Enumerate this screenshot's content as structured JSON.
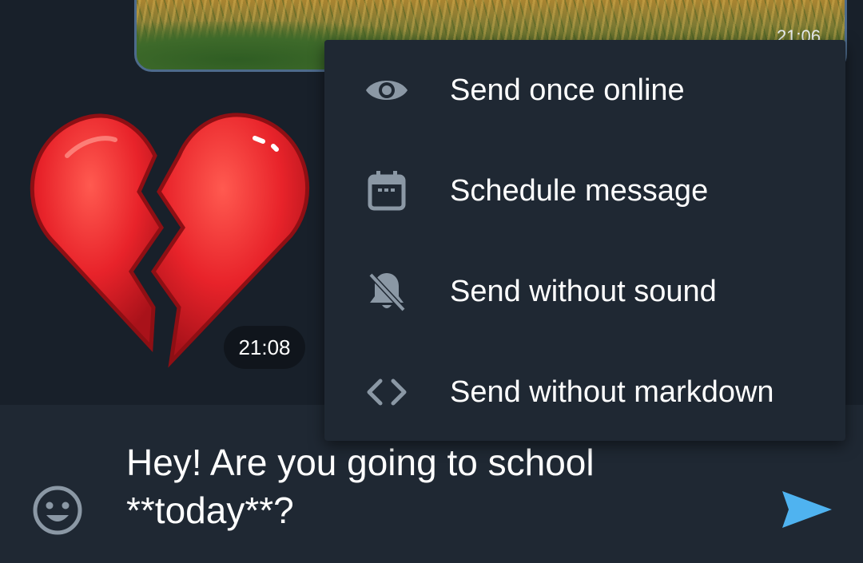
{
  "photo_message": {
    "time": "21:06"
  },
  "sticker_message": {
    "emoji_name": "broken-heart",
    "time": "21:08"
  },
  "send_menu": {
    "items": [
      {
        "label": "Send once online",
        "icon": "eye-icon"
      },
      {
        "label": "Schedule message",
        "icon": "calendar-icon"
      },
      {
        "label": "Send without sound",
        "icon": "bell-off-icon"
      },
      {
        "label": "Send without markdown",
        "icon": "code-icon"
      }
    ]
  },
  "composer": {
    "text": "Hey! Are you going to school\n**today**?",
    "emoji_icon": "smiley-icon",
    "send_icon": "send-icon"
  },
  "colors": {
    "background": "#18202a",
    "menu_background": "#1f2833",
    "icon_gray": "#8b98a5",
    "send_blue": "#4fb3f0",
    "heart_red": "#e8232a"
  }
}
